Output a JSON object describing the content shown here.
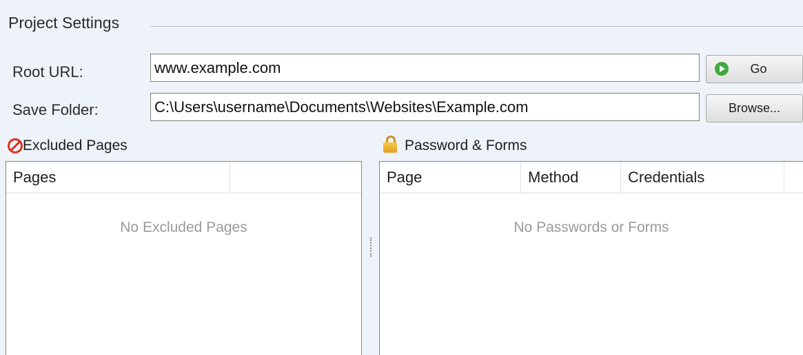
{
  "project_settings": {
    "title": "Project Settings",
    "root_url": {
      "label": "Root URL:",
      "value": "www.example.com"
    },
    "save_folder": {
      "label": "Save Folder:",
      "value": "C:\\Users\\username\\Documents\\Websites\\Example.com"
    },
    "go_button": {
      "label": "Go",
      "icon": "play-circle-icon"
    },
    "browse_button": {
      "label": "Browse..."
    }
  },
  "excluded_pages": {
    "title": "Excluded Pages",
    "icon": "no-entry-icon",
    "columns": [
      "Pages",
      ""
    ],
    "empty_text": "No Excluded Pages"
  },
  "password_forms": {
    "title": "Password & Forms",
    "icon": "lock-icon",
    "columns": [
      "Page",
      "Method",
      "Credentials"
    ],
    "empty_text": "No Passwords or Forms"
  },
  "colors": {
    "background": "#eef3f9",
    "error_red": "#e0301e",
    "go_green": "#3caa3c",
    "lock_gold": "#e3a125"
  }
}
